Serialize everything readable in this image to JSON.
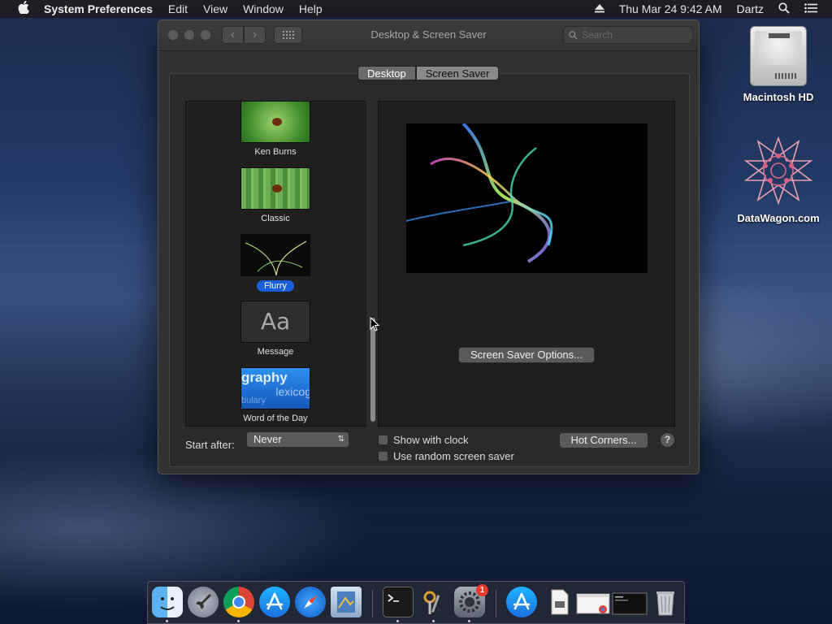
{
  "menubar": {
    "apple": "",
    "app_name": "System Preferences",
    "items": [
      "Edit",
      "View",
      "Window",
      "Help"
    ],
    "clock": "Thu Mar 24  9:42 AM",
    "user": "Dartz"
  },
  "window": {
    "title": "Desktop & Screen Saver",
    "search_placeholder": "Search",
    "tabs": [
      "Desktop",
      "Screen Saver"
    ],
    "active_tab": "Screen Saver",
    "screensavers": [
      {
        "label": "Ken Burns"
      },
      {
        "label": "Classic"
      },
      {
        "label": "Flurry",
        "selected": true
      },
      {
        "label": "Message",
        "thumb_text": "Aa"
      },
      {
        "label": "Word of the Day",
        "thumb_words": [
          "graphy",
          "lexicog",
          "bulary"
        ]
      }
    ],
    "options_button": "Screen Saver Options...",
    "start_after_label": "Start after:",
    "start_after_value": "Never",
    "show_with_clock": "Show with clock",
    "use_random": "Use random screen saver",
    "hot_corners_button": "Hot Corners...",
    "help": "?"
  },
  "desktop_icons": [
    {
      "label": "Macintosh HD"
    },
    {
      "label": "DataWagon.com"
    }
  ],
  "dock": {
    "items": [
      "finder-icon",
      "launchpad-icon",
      "chrome-icon",
      "app-store-icon",
      "safari-icon",
      "preview-icon",
      "terminal-icon",
      "keychain-icon",
      "system-preferences-icon",
      "app-store-download-icon",
      "document-icon",
      "chrome-window-icon",
      "terminal-window-icon",
      "trash-icon"
    ],
    "badge_count": "1"
  },
  "colors": {
    "selection": "#1a5fd8",
    "badge": "#e8372b"
  }
}
